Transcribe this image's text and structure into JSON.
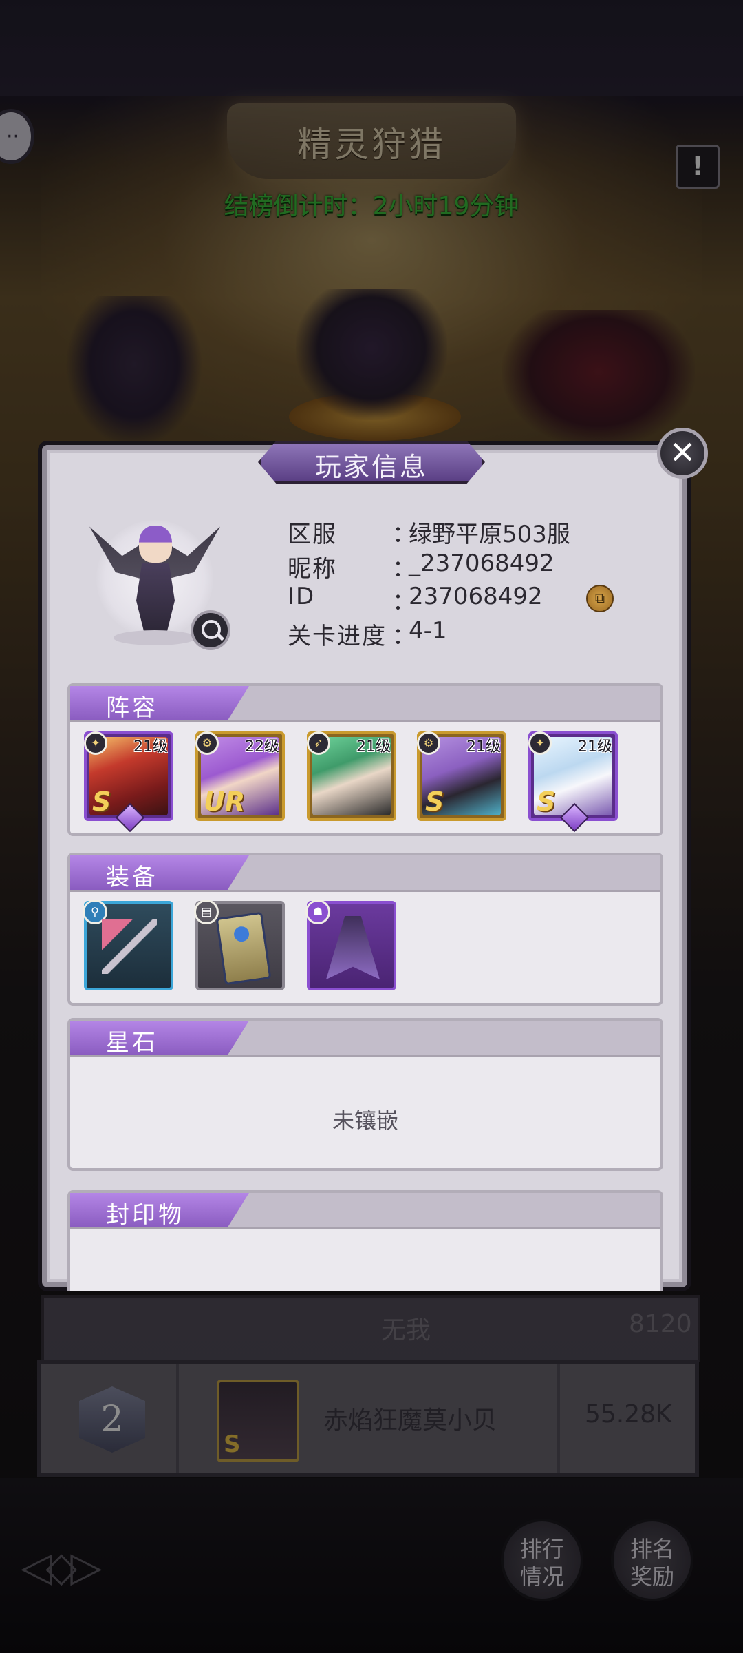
{
  "event": {
    "title": "精灵狩猎",
    "countdown": "结榜倒计时：2小时19分钟"
  },
  "ranking": {
    "row1": {
      "name": "无我",
      "score": "8120"
    },
    "row2": {
      "rank": "2",
      "rarity": "S",
      "name": "赤焰狂魔莫小贝",
      "score": "55.28K"
    }
  },
  "buttons": {
    "ranking_status": "排行情况",
    "rank_reward": "排名奖励"
  },
  "dialog": {
    "title": "玩家信息",
    "close": "✕",
    "player": {
      "server_label": "区服",
      "server_value": "绿野平原503服",
      "nickname_label": "昵称",
      "nickname_value": "_237068492",
      "id_label": "ID",
      "id_value": "237068492",
      "progress_label": "关卡进度",
      "progress_value": "4-1",
      "colon": "："
    },
    "sections": {
      "lineup": "阵容",
      "equipment": "装备",
      "star_stone": "星石",
      "seal": "封印物"
    },
    "star_stone_empty": "未镶嵌",
    "lineup": [
      {
        "level": "21级",
        "rarity": "S",
        "class_icon": "wand-icon",
        "frame": "purple"
      },
      {
        "level": "22级",
        "rarity": "UR",
        "class_icon": "gear-icon",
        "frame": "gold"
      },
      {
        "level": "21级",
        "rarity": "",
        "class_icon": "rifle-icon",
        "frame": "gold"
      },
      {
        "level": "21级",
        "rarity": "S",
        "class_icon": "gear-icon",
        "frame": "gold"
      },
      {
        "level": "21级",
        "rarity": "S",
        "class_icon": "wand-icon",
        "frame": "purple"
      }
    ],
    "equipment": [
      {
        "item": "heart-wand-icon",
        "slot_icon": "weapon-slot-icon",
        "color": "#3ca6d8"
      },
      {
        "item": "card-book-icon",
        "slot_icon": "book-slot-icon",
        "color": "#8a8690"
      },
      {
        "item": "cloak-icon",
        "slot_icon": "armor-slot-icon",
        "color": "#8a4fd0"
      }
    ]
  },
  "colors": {
    "accent_purple": "#8a5cc0",
    "countdown_green": "#3cc43c",
    "rarity_gold": "#f3cf59"
  }
}
